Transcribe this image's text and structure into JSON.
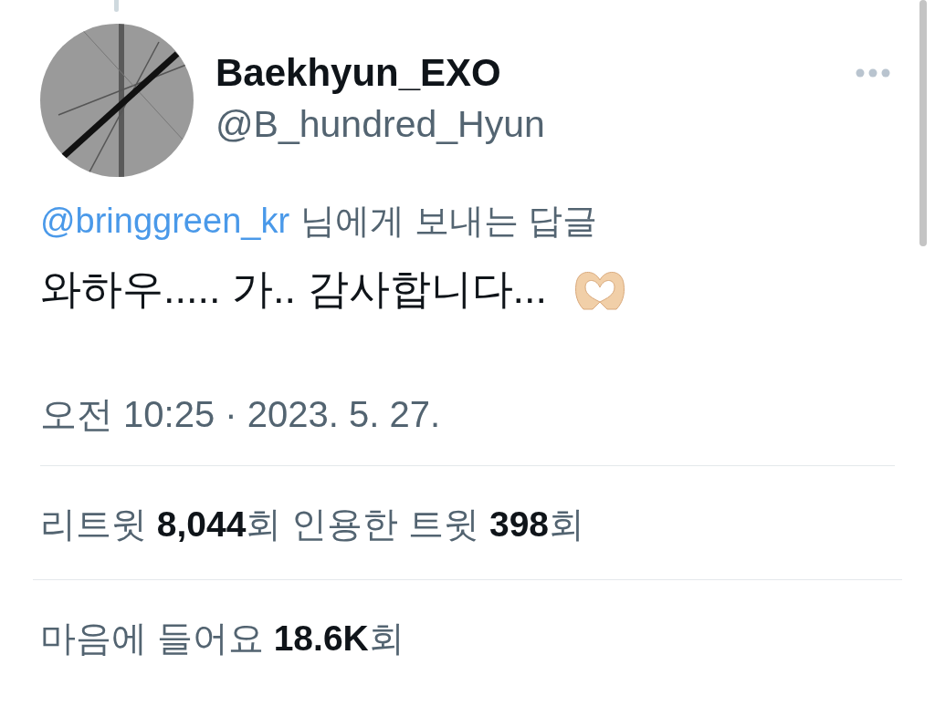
{
  "author": {
    "name": "Baekhyun_EXO",
    "handle": "@B_hundred_Hyun"
  },
  "reply_to": {
    "mention": "@bringgreen_kr",
    "suffix": "님에게 보내는 답글"
  },
  "text": "와하우..... 가.. 감사합니다...",
  "timestamp": "오전 10:25 · 2023. 5. 27.",
  "stats": [
    "리트윗 **8,044**회  인용한 트윗 **398**회",
    "마음에 들어요 **18.6K**회"
  ]
}
